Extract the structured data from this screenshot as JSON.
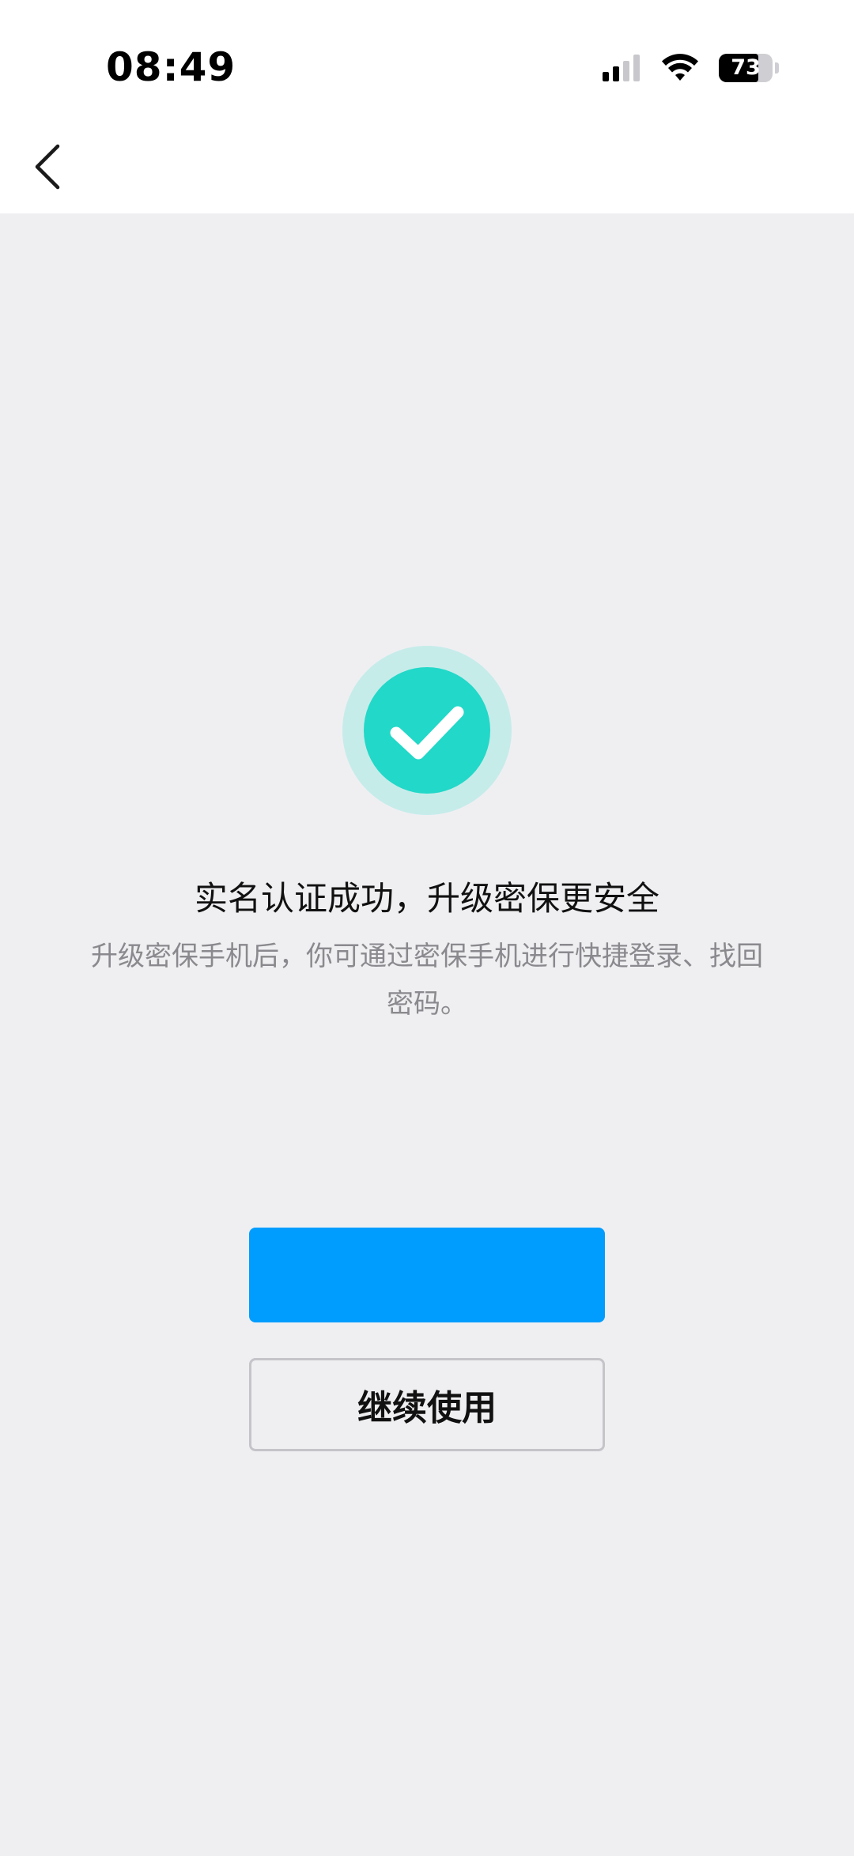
{
  "status_bar": {
    "time": "08:49",
    "battery": "73",
    "battery_level": 0.73,
    "signal_bars_active": 2,
    "signal_bars_total": 4,
    "icons": [
      "signal-icon",
      "wifi-icon",
      "battery-icon"
    ]
  },
  "nav": {
    "back_icon": "chevron-left-icon"
  },
  "result": {
    "icon": "check-circle-icon",
    "accent_color": "#22D8C8",
    "halo_color": "#C6ECEA",
    "title": "实名认证成功，升级密保更安全",
    "description": "升级密保手机后，你可通过密保手机进行快捷登录、找回密码。"
  },
  "actions": {
    "primary_label": "",
    "primary_color": "#009DFF",
    "secondary_label": "继续使用"
  }
}
